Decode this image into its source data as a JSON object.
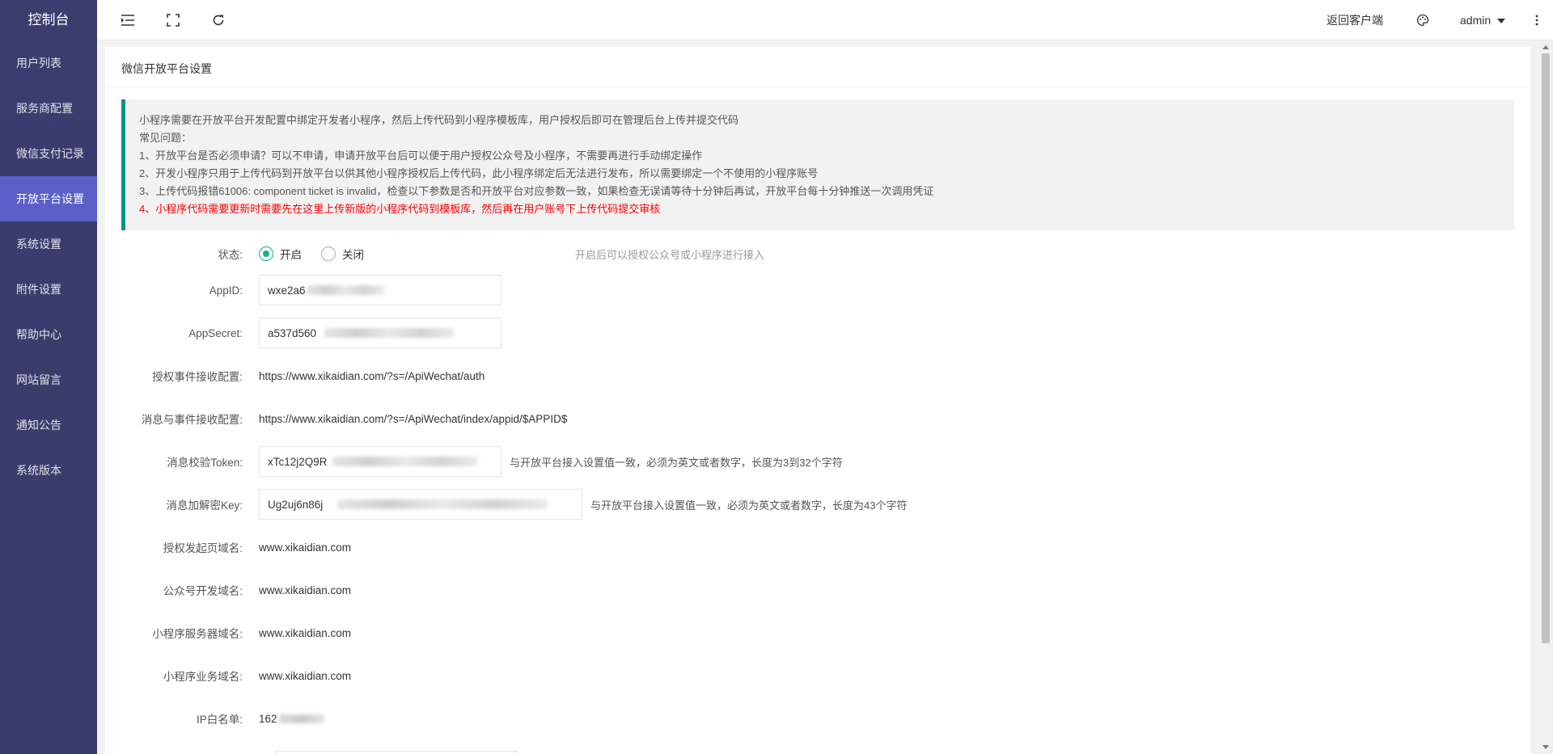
{
  "sidebar": {
    "title": "控制台",
    "items": [
      {
        "label": "用户列表"
      },
      {
        "label": "服务商配置"
      },
      {
        "label": "微信支付记录"
      },
      {
        "label": "开放平台设置"
      },
      {
        "label": "系统设置"
      },
      {
        "label": "附件设置"
      },
      {
        "label": "帮助中心"
      },
      {
        "label": "网站留言"
      },
      {
        "label": "通知公告"
      },
      {
        "label": "系统版本"
      }
    ],
    "active_index": 3
  },
  "header": {
    "back_link": "返回客户端",
    "user": "admin"
  },
  "page": {
    "title": "微信开放平台设置"
  },
  "notice": {
    "lines": [
      "小程序需要在开放平台开发配置中绑定开发者小程序，然后上传代码到小程序模板库，用户授权后即可在管理后台上传并提交代码",
      "常见问题：",
      "1、开放平台是否必须申请？可以不申请，申请开放平台后可以便于用户授权公众号及小程序，不需要再进行手动绑定操作",
      "2、开发小程序只用于上传代码到开放平台以供其他小程序授权后上传代码，此小程序绑定后无法进行发布，所以需要绑定一个不使用的小程序账号",
      "3、上传代码报错61006: component ticket is invalid，检查以下参数是否和开放平台对应参数一致，如果检查无误请等待十分钟后再试，开放平台每十分钟推送一次调用凭证"
    ],
    "warning": "4、小程序代码需要更新时需要先在这里上传新版的小程序代码到模板库，然后再在用户账号下上传代码提交审核"
  },
  "form": {
    "status": {
      "label": "状态:",
      "options": [
        "开启",
        "关闭"
      ],
      "selected": "开启",
      "hint": "开启后可以授权公众号或小程序进行接入"
    },
    "appid": {
      "label": "AppID:",
      "value": "wxe2a6"
    },
    "appsecret": {
      "label": "AppSecret:",
      "value": "a537d560"
    },
    "auth_event": {
      "label": "授权事件接收配置:",
      "value": "https://www.xikaidian.com/?s=/ApiWechat/auth"
    },
    "msg_event": {
      "label": "消息与事件接收配置:",
      "value": "https://www.xikaidian.com/?s=/ApiWechat/index/appid/$APPID$"
    },
    "token": {
      "label": "消息校验Token:",
      "value": "xTc12j2Q9R",
      "hint": "与开放平台接入设置值一致，必须为英文或者数字，长度为3到32个字符"
    },
    "aeskey": {
      "label": "消息加解密Key:",
      "value": "Ug2uj6n86j",
      "hint": "与开放平台接入设置值一致，必须为英文或者数字，长度为43个字符"
    },
    "auth_domain": {
      "label": "授权发起页域名:",
      "value": "www.xikaidian.com"
    },
    "mp_domain": {
      "label": "公众号开发域名:",
      "value": "www.xikaidian.com"
    },
    "mini_server_domain": {
      "label": "小程序服务器域名:",
      "value": "www.xikaidian.com"
    },
    "mini_biz_domain": {
      "label": "小程序业务域名:",
      "value": "www.xikaidian.com"
    },
    "ip_whitelist": {
      "label": "IP白名单:",
      "value": "162"
    }
  }
}
